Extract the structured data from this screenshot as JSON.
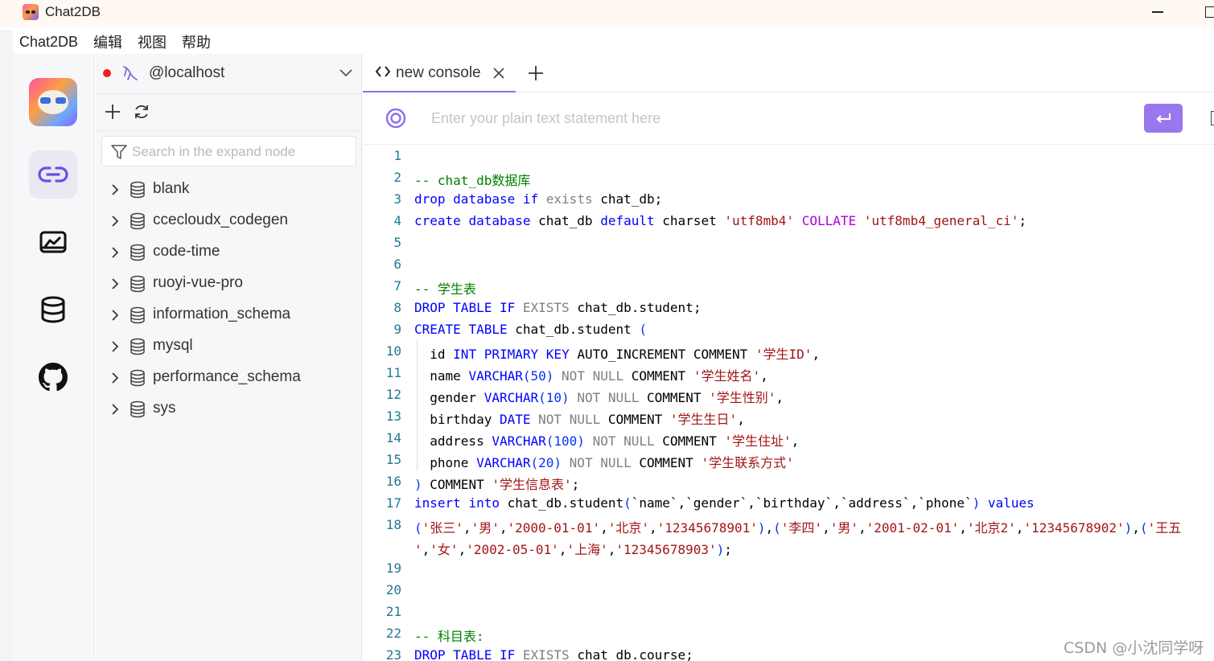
{
  "window": {
    "title": "Chat2DB"
  },
  "menu": [
    "Chat2DB",
    "编辑",
    "视图",
    "帮助"
  ],
  "activity_bar": {
    "items": [
      {
        "name": "chat2db-logo",
        "icon": "chat2db-logo-icon"
      },
      {
        "name": "connections",
        "icon": "link-icon"
      },
      {
        "name": "dashboard",
        "icon": "chart-icon"
      },
      {
        "name": "database",
        "icon": "database-icon"
      },
      {
        "name": "github",
        "icon": "github-icon"
      }
    ]
  },
  "sidebar": {
    "connection": {
      "name": "@localhost",
      "status_color": "#e8211c"
    },
    "search_placeholder": "Search in the expand node",
    "databases": [
      "blank",
      "ccecloudx_codegen",
      "code-time",
      "ruoyi-vue-pro",
      "information_schema",
      "mysql",
      "performance_schema",
      "sys"
    ]
  },
  "editor": {
    "tab": {
      "label": "new console"
    },
    "prompt_placeholder": "Enter your plain text statement here",
    "accent": "#9877f0",
    "line_numbers": [
      "1",
      "2",
      "3",
      "4",
      "5",
      "6",
      "7",
      "8",
      "9",
      "10",
      "11",
      "12",
      "13",
      "14",
      "15",
      "16",
      "17",
      "18",
      "",
      "19",
      "20",
      "21",
      "22",
      "23"
    ],
    "lines": [
      [],
      [
        [
          "cm",
          "-- chat_db数据库"
        ]
      ],
      [
        [
          "kw",
          "drop"
        ],
        [
          "t",
          " "
        ],
        [
          "kw",
          "database"
        ],
        [
          "t",
          " "
        ],
        [
          "kw",
          "if"
        ],
        [
          "t",
          " "
        ],
        [
          "gr",
          "exists"
        ],
        [
          "t",
          " chat_db;"
        ]
      ],
      [
        [
          "kw",
          "create"
        ],
        [
          "t",
          " "
        ],
        [
          "kw",
          "database"
        ],
        [
          "t",
          " chat_db "
        ],
        [
          "kw",
          "default"
        ],
        [
          "t",
          " charset "
        ],
        [
          "str",
          "'utf8mb4'"
        ],
        [
          "t",
          " "
        ],
        [
          "pl",
          "COLLATE"
        ],
        [
          "t",
          " "
        ],
        [
          "str",
          "'utf8mb4_general_ci'"
        ],
        [
          "t",
          ";"
        ]
      ],
      [],
      [],
      [
        [
          "cm",
          "-- 学生表"
        ]
      ],
      [
        [
          "kw",
          "DROP"
        ],
        [
          "t",
          " "
        ],
        [
          "kw",
          "TABLE"
        ],
        [
          "t",
          " "
        ],
        [
          "kw",
          "IF"
        ],
        [
          "t",
          " "
        ],
        [
          "gr",
          "EXISTS"
        ],
        [
          "t",
          " chat_db.student;"
        ]
      ],
      [
        [
          "kw",
          "CREATE"
        ],
        [
          "t",
          " "
        ],
        [
          "kw",
          "TABLE"
        ],
        [
          "t",
          " chat_db.student "
        ],
        [
          "par",
          "("
        ]
      ],
      [
        [
          "t",
          "  id "
        ],
        [
          "kw",
          "INT"
        ],
        [
          "t",
          " "
        ],
        [
          "kw",
          "PRIMARY"
        ],
        [
          "t",
          " "
        ],
        [
          "kw",
          "KEY"
        ],
        [
          "t",
          " AUTO_INCREMENT COMMENT "
        ],
        [
          "str",
          "'学生ID'"
        ],
        [
          "t",
          ","
        ]
      ],
      [
        [
          "t",
          "  name "
        ],
        [
          "kw",
          "VARCHAR"
        ],
        [
          "par",
          "(50)"
        ],
        [
          "t",
          " "
        ],
        [
          "gr",
          "NOT"
        ],
        [
          "t",
          " "
        ],
        [
          "gr",
          "NULL"
        ],
        [
          "t",
          " COMMENT "
        ],
        [
          "str",
          "'学生姓名'"
        ],
        [
          "t",
          ","
        ]
      ],
      [
        [
          "t",
          "  gender "
        ],
        [
          "kw",
          "VARCHAR"
        ],
        [
          "par",
          "(10)"
        ],
        [
          "t",
          " "
        ],
        [
          "gr",
          "NOT"
        ],
        [
          "t",
          " "
        ],
        [
          "gr",
          "NULL"
        ],
        [
          "t",
          " COMMENT "
        ],
        [
          "str",
          "'学生性别'"
        ],
        [
          "t",
          ","
        ]
      ],
      [
        [
          "t",
          "  birthday "
        ],
        [
          "kw",
          "DATE"
        ],
        [
          "t",
          " "
        ],
        [
          "gr",
          "NOT"
        ],
        [
          "t",
          " "
        ],
        [
          "gr",
          "NULL"
        ],
        [
          "t",
          " COMMENT "
        ],
        [
          "str",
          "'学生生日'"
        ],
        [
          "t",
          ","
        ]
      ],
      [
        [
          "t",
          "  address "
        ],
        [
          "kw",
          "VARCHAR"
        ],
        [
          "par",
          "(100)"
        ],
        [
          "t",
          " "
        ],
        [
          "gr",
          "NOT"
        ],
        [
          "t",
          " "
        ],
        [
          "gr",
          "NULL"
        ],
        [
          "t",
          " COMMENT "
        ],
        [
          "str",
          "'学生住址'"
        ],
        [
          "t",
          ","
        ]
      ],
      [
        [
          "t",
          "  phone "
        ],
        [
          "kw",
          "VARCHAR"
        ],
        [
          "par",
          "(20)"
        ],
        [
          "t",
          " "
        ],
        [
          "gr",
          "NOT"
        ],
        [
          "t",
          " "
        ],
        [
          "gr",
          "NULL"
        ],
        [
          "t",
          " COMMENT "
        ],
        [
          "str",
          "'学生联系方式'"
        ]
      ],
      [
        [
          "par",
          ")"
        ],
        [
          "t",
          " COMMENT "
        ],
        [
          "str",
          "'学生信息表'"
        ],
        [
          "t",
          ";"
        ]
      ],
      [
        [
          "kw",
          "insert"
        ],
        [
          "t",
          " "
        ],
        [
          "kw",
          "into"
        ],
        [
          "t",
          " chat_db.student"
        ],
        [
          "par",
          "("
        ],
        [
          "t",
          "`name`,`gender`,`birthday`,`address`,`phone`"
        ],
        [
          "par",
          ")"
        ],
        [
          "t",
          " "
        ],
        [
          "kw",
          "values"
        ]
      ],
      [
        [
          "par",
          "("
        ],
        [
          "str",
          "'张三'"
        ],
        [
          "t",
          ","
        ],
        [
          "str",
          "'男'"
        ],
        [
          "t",
          ","
        ],
        [
          "str",
          "'2000-01-01'"
        ],
        [
          "t",
          ","
        ],
        [
          "str",
          "'北京'"
        ],
        [
          "t",
          ","
        ],
        [
          "str",
          "'12345678901'"
        ],
        [
          "par",
          ")"
        ],
        [
          "t",
          ","
        ],
        [
          "par",
          "("
        ],
        [
          "str",
          "'李四'"
        ],
        [
          "t",
          ","
        ],
        [
          "str",
          "'男'"
        ],
        [
          "t",
          ","
        ],
        [
          "str",
          "'2001-02-01'"
        ],
        [
          "t",
          ","
        ],
        [
          "str",
          "'北京2'"
        ],
        [
          "t",
          ","
        ],
        [
          "str",
          "'12345678902'"
        ],
        [
          "par",
          ")"
        ],
        [
          "t",
          ","
        ],
        [
          "par",
          "("
        ],
        [
          "str",
          "'王五"
        ]
      ],
      [
        [
          "str",
          "'"
        ],
        [
          "t",
          ","
        ],
        [
          "str",
          "'女'"
        ],
        [
          "t",
          ","
        ],
        [
          "str",
          "'2002-05-01'"
        ],
        [
          "t",
          ","
        ],
        [
          "str",
          "'上海'"
        ],
        [
          "t",
          ","
        ],
        [
          "str",
          "'12345678903'"
        ],
        [
          "par",
          ")"
        ],
        [
          "t",
          ";"
        ]
      ],
      [],
      [],
      [],
      [
        [
          "cm",
          "-- 科目表:"
        ]
      ],
      [
        [
          "kw",
          "DROP"
        ],
        [
          "t",
          " "
        ],
        [
          "kw",
          "TABLE"
        ],
        [
          "t",
          " "
        ],
        [
          "kw",
          "IF"
        ],
        [
          "t",
          " "
        ],
        [
          "gr",
          "EXISTS"
        ],
        [
          "t",
          " chat_db.course;"
        ]
      ]
    ]
  },
  "watermark": "CSDN @小沈同学呀"
}
